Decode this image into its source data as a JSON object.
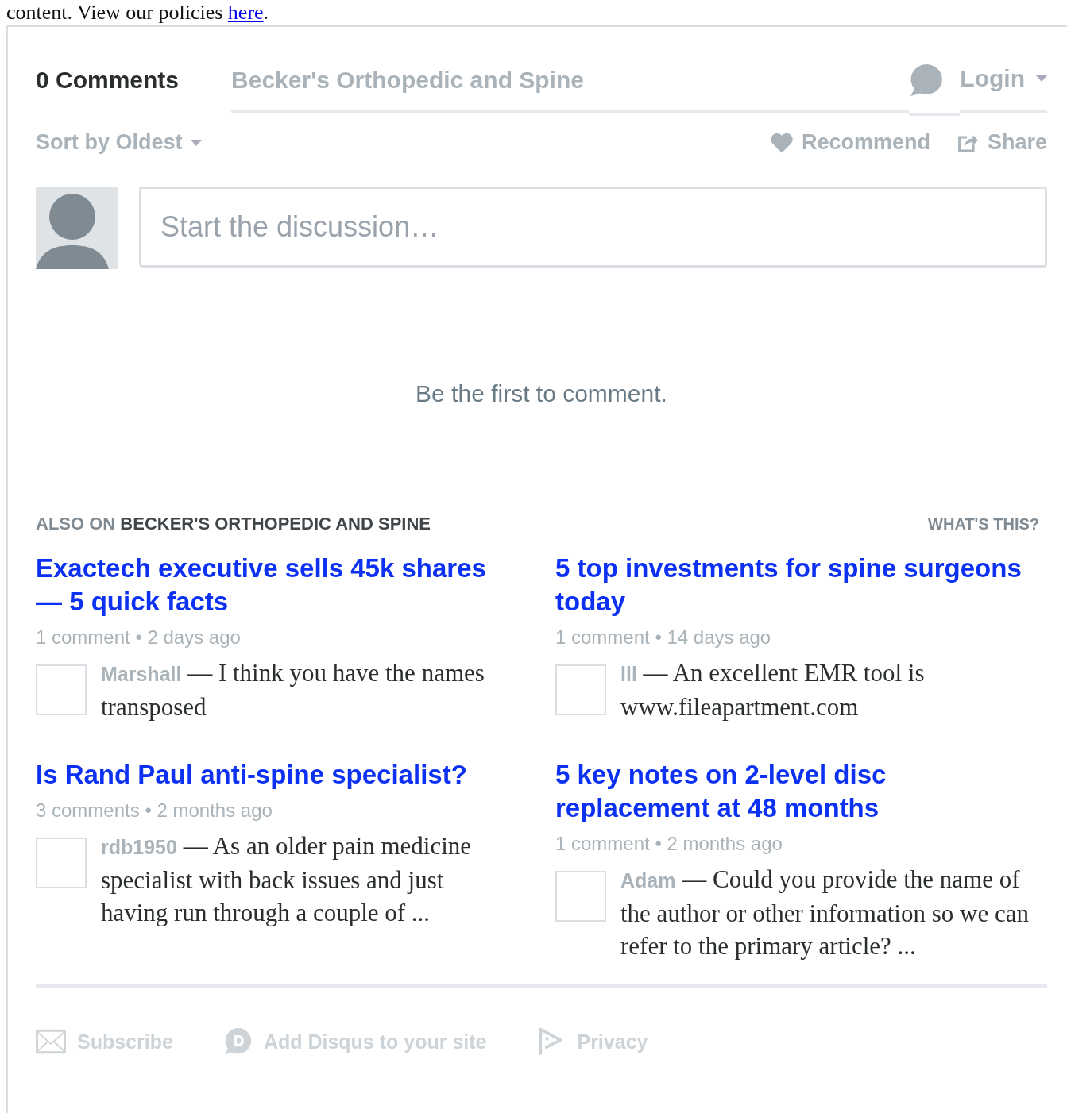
{
  "notice": {
    "text": "content. View our policies",
    "link": "here",
    "end": "."
  },
  "header": {
    "tabs": [
      {
        "label": "0 Comments",
        "selected": true
      },
      {
        "label": "Becker's Orthopedic and Spine",
        "selected": false
      }
    ],
    "login": "Login"
  },
  "toolbar": {
    "sort": "Sort by Oldest",
    "recommend": "Recommend",
    "share": "Share"
  },
  "composer": {
    "placeholder": "Start the discussion…"
  },
  "empty_message": "Be the first to comment.",
  "also_on": {
    "prefix": "ALSO ON",
    "site": "BECKER'S ORTHOPEDIC AND SPINE",
    "help": "WHAT'S THIS?",
    "items": [
      {
        "title": "Exactech executive sells 45k shares — 5 quick facts",
        "meta": "1 comment • 2 days ago",
        "author": "Marshall",
        "excerpt": "— I think you have the names transposed"
      },
      {
        "title": "5 top investments for spine surgeons today",
        "meta": "1 comment • 14 days ago",
        "author": "lll",
        "excerpt": "— An excellent EMR tool is www.fileapartment.com"
      },
      {
        "title": "Is Rand Paul anti-spine specialist?",
        "meta": "3 comments • 2 months ago",
        "author": "rdb1950",
        "excerpt": "— As an older pain medicine specialist with back issues and just having run through a couple of ..."
      },
      {
        "title": "5 key notes on 2-level disc replacement at 48 months",
        "meta": "1 comment • 2 months ago",
        "author": "Adam",
        "excerpt": "— Could you provide the name of the author or other information so we can refer to the primary article? ..."
      }
    ]
  },
  "footer": [
    {
      "kind": "subscribe",
      "label": "Subscribe"
    },
    {
      "kind": "disqus",
      "label": "Add Disqus to your site"
    },
    {
      "kind": "privacy",
      "label": "Privacy"
    }
  ]
}
